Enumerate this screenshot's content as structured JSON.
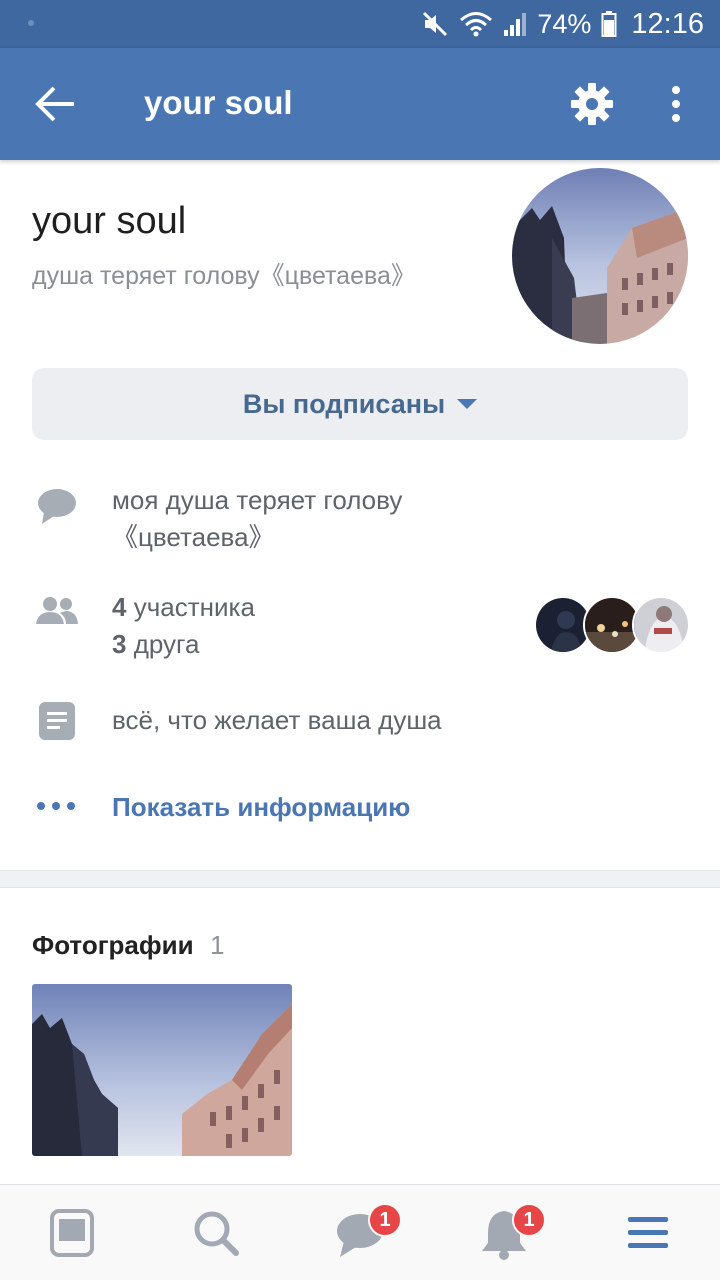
{
  "status_bar": {
    "battery": "74%",
    "time": "12:16",
    "icons": [
      "mute-icon",
      "wifi-icon",
      "signal-icon",
      "battery-icon"
    ]
  },
  "app_bar": {
    "title": "your soul",
    "back_icon": "arrow-left-icon",
    "settings_icon": "gear-icon",
    "more_icon": "more-vertical-icon"
  },
  "header": {
    "name": "your soul",
    "status": "душа теряет голову《цветаева》"
  },
  "subscribe_button": {
    "label": "Вы подписаны"
  },
  "info": {
    "description_lines": [
      "моя душа теряет голову",
      "《цветаева》"
    ],
    "members_count": "4",
    "members_word": "участника",
    "friends_count": "3",
    "friends_word": "друга",
    "about": "всё, что желает ваша душа",
    "show_more": "Показать информацию"
  },
  "photos": {
    "title": "Фотографии",
    "count": "1"
  },
  "bottom_nav": {
    "items": [
      {
        "icon": "news-icon"
      },
      {
        "icon": "search-icon"
      },
      {
        "icon": "messages-icon",
        "badge": "1"
      },
      {
        "icon": "notifications-icon",
        "badge": "1"
      },
      {
        "icon": "menu-icon"
      }
    ]
  },
  "colors": {
    "brand": "#4a76b4",
    "status_bar": "#3f67a0",
    "badge": "#e64646",
    "link": "#4a76b4"
  }
}
